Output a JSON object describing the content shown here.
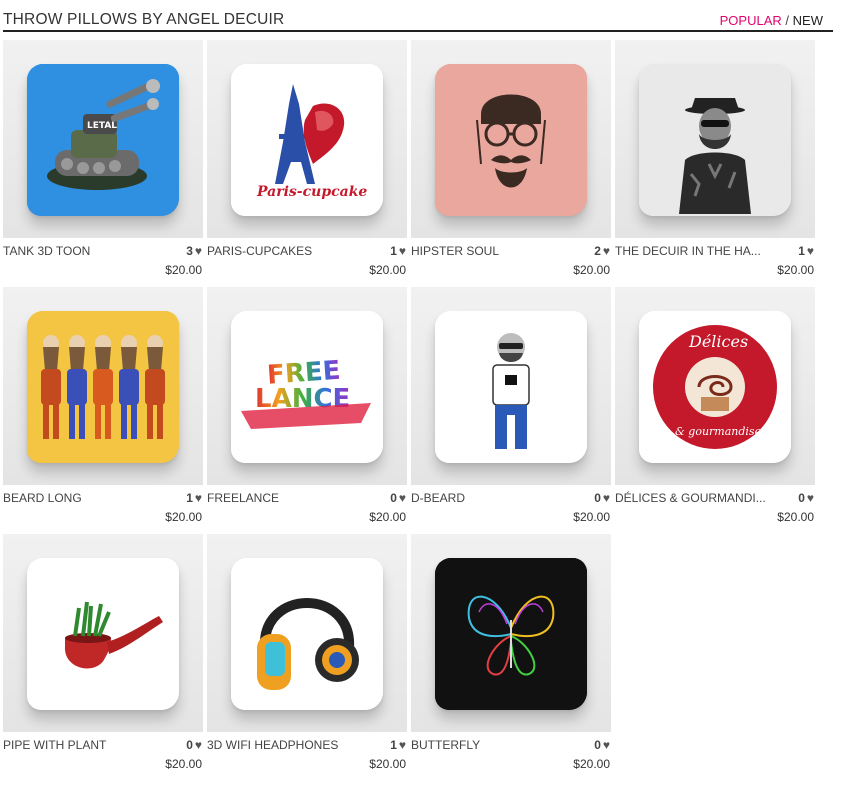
{
  "header": {
    "title": "THROW PILLOWS BY ANGEL DECUIR",
    "sort_popular": "POPULAR",
    "sort_separator": "/",
    "sort_new": "NEW"
  },
  "products": [
    {
      "name": "TANK 3D TOON",
      "likes": "3",
      "price": "$20.00",
      "bg": "#2f8fe0",
      "art": "tank"
    },
    {
      "name": "PARIS-CUPCAKES",
      "likes": "1",
      "price": "$20.00",
      "bg": "#ffffff",
      "art": "paris",
      "art_text": "Paris-cupcake"
    },
    {
      "name": "HIPSTER SOUL",
      "likes": "2",
      "price": "$20.00",
      "bg": "#eaa79e",
      "art": "hipster"
    },
    {
      "name": "THE DECUIR IN THE HA...",
      "likes": "1",
      "price": "$20.00",
      "bg": "#e9e9e9",
      "art": "portrait"
    },
    {
      "name": "BEARD LONG",
      "likes": "1",
      "price": "$20.00",
      "bg": "#f4c542",
      "art": "beards"
    },
    {
      "name": "FREELANCE",
      "likes": "0",
      "price": "$20.00",
      "bg": "#ffffff",
      "art": "freelance",
      "art_text": [
        "FREE",
        "LANCE"
      ]
    },
    {
      "name": "D-BEARD",
      "likes": "0",
      "price": "$20.00",
      "bg": "#ffffff",
      "art": "dbeard"
    },
    {
      "name": "DÉLICES & GOURMANDI...",
      "likes": "0",
      "price": "$20.00",
      "bg": "#ffffff",
      "art": "delices",
      "art_text": [
        "Délices",
        "& gourmandises"
      ]
    },
    {
      "name": "PIPE WITH PLANT",
      "likes": "0",
      "price": "$20.00",
      "bg": "#ffffff",
      "art": "pipe"
    },
    {
      "name": "3D WIFI HEADPHONES",
      "likes": "1",
      "price": "$20.00",
      "bg": "#ffffff",
      "art": "headphones"
    },
    {
      "name": "BUTTERFLY",
      "likes": "0",
      "price": "$20.00",
      "bg": "#111111",
      "art": "butterfly"
    }
  ]
}
